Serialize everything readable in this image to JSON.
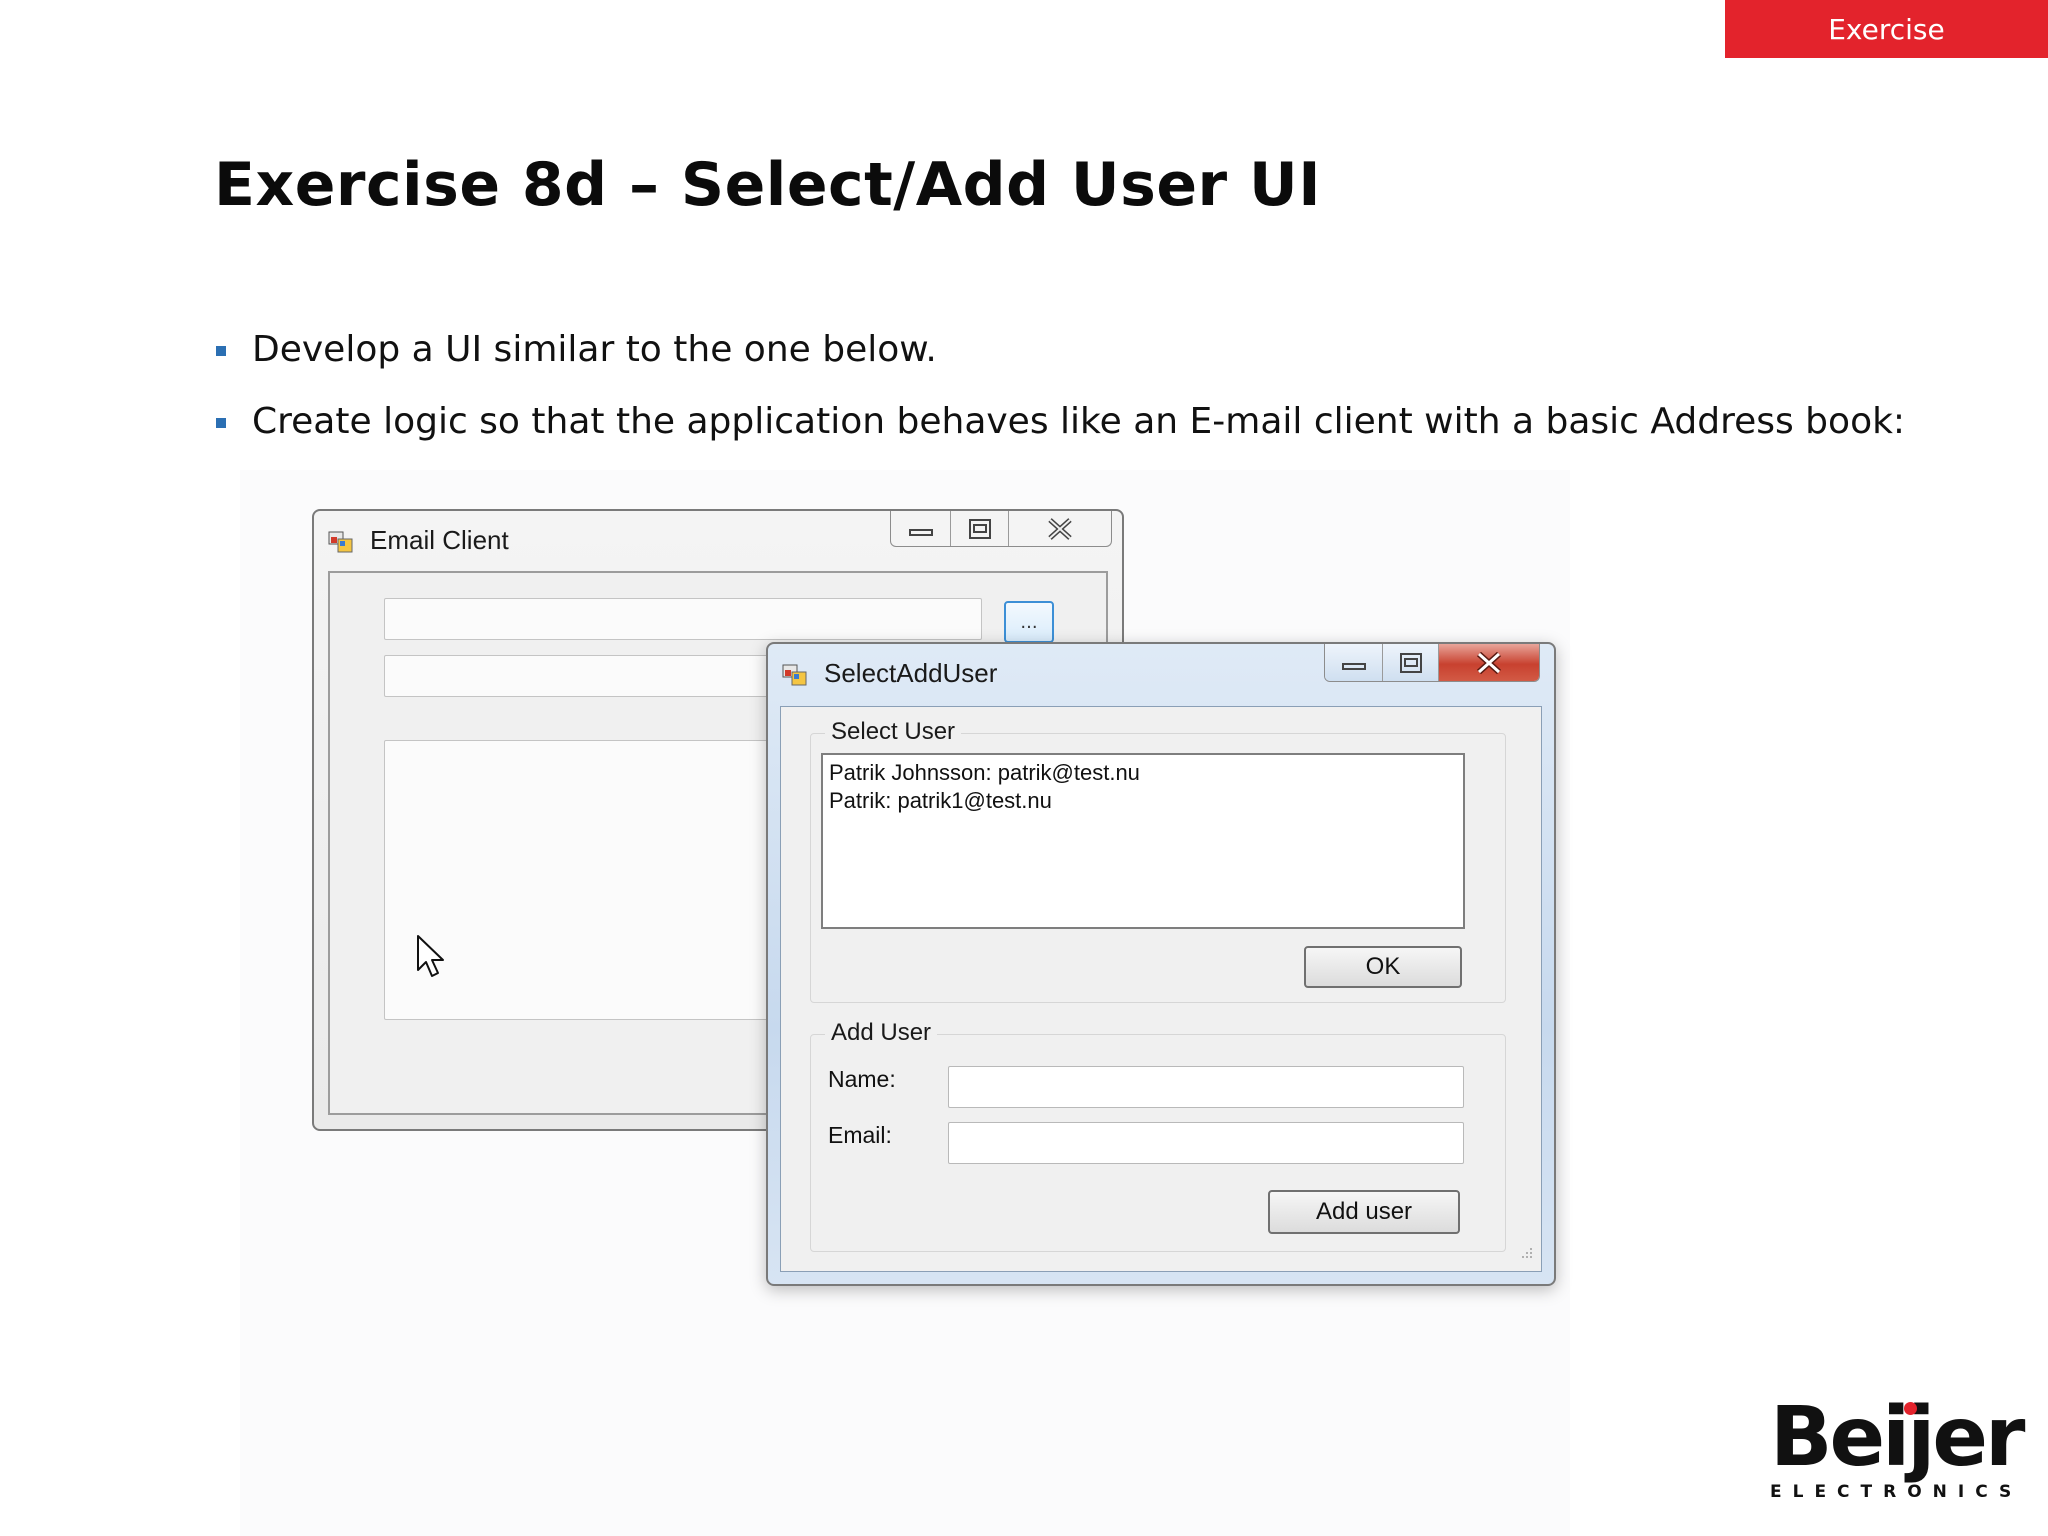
{
  "header": {
    "tag": "Exercise"
  },
  "slide": {
    "title": "Exercise 8d – Select/Add User UI",
    "bullets": [
      "Develop a UI similar to the one below.",
      "Create logic so that the application behaves like an E-mail client with a basic Address book:"
    ]
  },
  "email_client": {
    "title": "Email Client",
    "browse_label": "..."
  },
  "dialog": {
    "title": "SelectAddUser",
    "select_group": {
      "legend": "Select User",
      "users": [
        "Patrik Johnsson: patrik@test.nu",
        "Patrik: patrik1@test.nu"
      ],
      "ok_label": "OK"
    },
    "add_group": {
      "legend": "Add User",
      "name_label": "Name:",
      "email_label": "Email:",
      "name_value": "",
      "email_value": "",
      "add_label": "Add user"
    }
  },
  "logo": {
    "name": "Beijer",
    "sub": "ELECTRONICS"
  },
  "colors": {
    "accent": "#e3232c",
    "bullet": "#2b6fb3",
    "focus": "#3c8fd6"
  }
}
